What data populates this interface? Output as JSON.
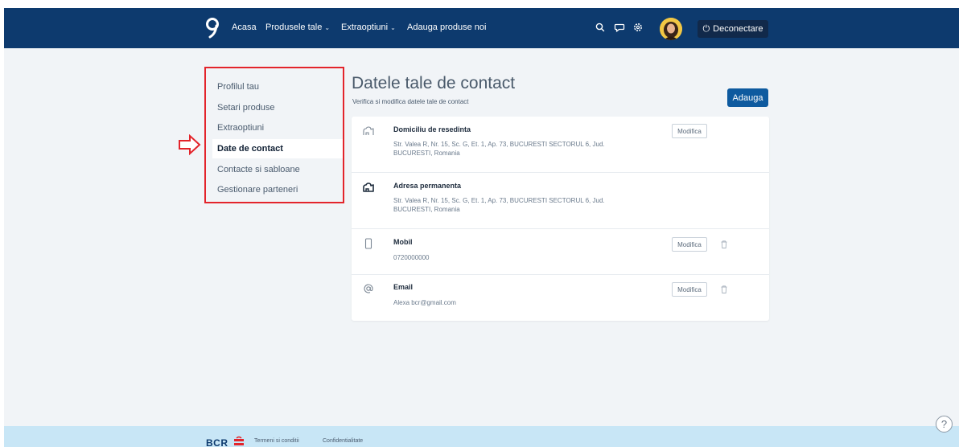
{
  "nav": {
    "home": "Acasa",
    "products": "Produsele tale",
    "extras": "Extraoptiuni",
    "add_products": "Adauga produse noi",
    "caret": "⌄",
    "logout_icon": "⏻",
    "logout": "Deconectare"
  },
  "sidebar": {
    "items": [
      {
        "label": "Profilul tau"
      },
      {
        "label": "Setari produse"
      },
      {
        "label": "Extraoptiuni"
      },
      {
        "label": "Date de contact"
      },
      {
        "label": "Contacte si sabloane"
      },
      {
        "label": "Gestionare parteneri"
      }
    ],
    "active_index": 3
  },
  "main": {
    "title": "Datele tale de contact",
    "subtitle": "Verifica si modifica datele tale de contact",
    "add_button": "Adauga",
    "rows": [
      {
        "icon": "home-outline-icon",
        "title": "Domiciliu de resedinta",
        "text": "Str. Valea R, Nr. 15, Sc. G, Et. 1, Ap. 73, BUCURESTI SECTORUL 6, Jud. BUCURESTI, Romania",
        "button": "Modifica"
      },
      {
        "icon": "home-filled-icon",
        "title": "Adresa permanenta",
        "text": "Str. Valea R, Nr. 15, Sc. G, Et. 1, Ap. 73, BUCURESTI SECTORUL 6, Jud. BUCURESTI, Romania"
      },
      {
        "icon": "phone-icon",
        "title": "Mobil",
        "text": "0720000000",
        "button": "Modifica"
      },
      {
        "icon": "at-sign-icon",
        "title": "Email",
        "text": "Alexa bcr@gmail.com",
        "button": "Modifica"
      }
    ]
  },
  "footer": {
    "brand": "BCR",
    "terms": "Termeni si conditii",
    "privacy": "Confidentialitate",
    "help": "?"
  },
  "colors": {
    "topbar": "#0d3a6e",
    "accent": "#0e5a9f",
    "highlight": "#e3242b",
    "footer": "#c8e6f6"
  }
}
